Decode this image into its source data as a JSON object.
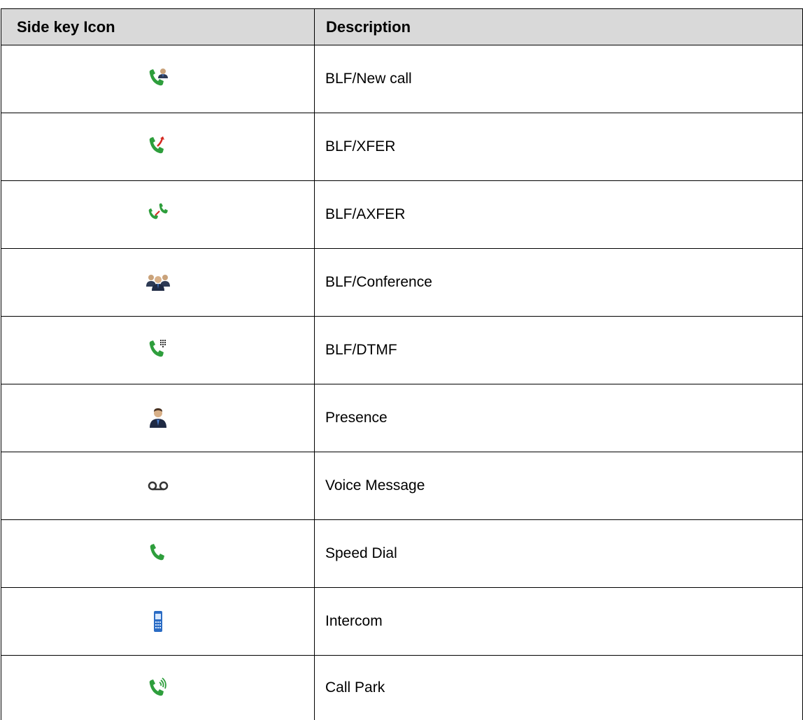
{
  "table": {
    "headers": {
      "icon": "Side key Icon",
      "description": "Description"
    },
    "rows": [
      {
        "icon": "phone-person-icon",
        "description": "BLF/New call"
      },
      {
        "icon": "phone-transfer-arrow-icon",
        "description": "BLF/XFER"
      },
      {
        "icon": "phone-attended-transfer-icon",
        "description": "BLF/AXFER"
      },
      {
        "icon": "conference-people-icon",
        "description": "BLF/Conference"
      },
      {
        "icon": "phone-keypad-icon",
        "description": "BLF/DTMF"
      },
      {
        "icon": "person-icon",
        "description": "Presence"
      },
      {
        "icon": "voicemail-icon",
        "description": "Voice Message"
      },
      {
        "icon": "phone-icon",
        "description": "Speed Dial"
      },
      {
        "icon": "mobile-phone-icon",
        "description": "Intercom"
      },
      {
        "icon": "phone-waves-icon",
        "description": "Call Park"
      }
    ]
  },
  "colors": {
    "header_bg": "#d9d9d9",
    "phone_green": "#2e9e3c",
    "arrow_red": "#d4281f",
    "mobile_blue": "#2b6cc4"
  }
}
